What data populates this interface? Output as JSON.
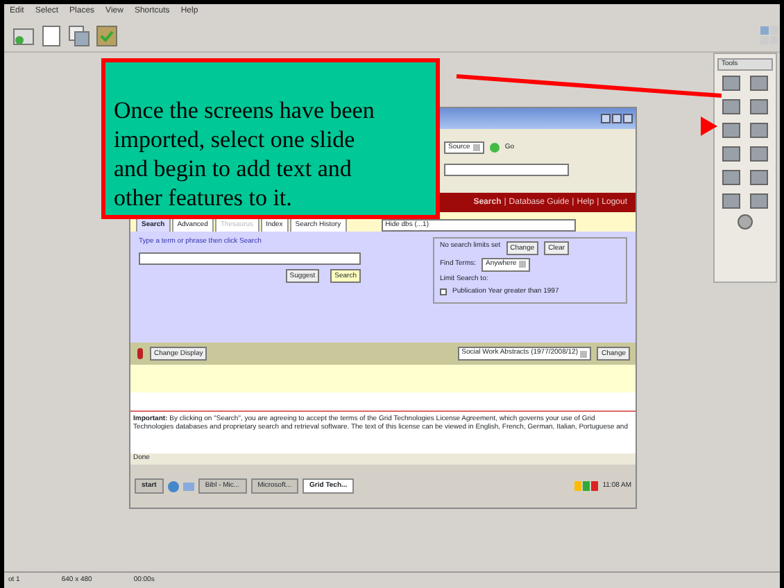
{
  "menu": [
    "Edit",
    "Select",
    "Places",
    "View",
    "Shortcuts",
    "Help"
  ],
  "callout": {
    "text": "Once the screens have been imported, select one slide and begin to add text and other features to it."
  },
  "slide": {
    "address_select": "Source",
    "go_label": "Go",
    "header_links": [
      "Search",
      "Database Guide",
      "Help",
      "Logout"
    ],
    "header_separator": "|",
    "tabs": [
      {
        "label": "Search",
        "selected": true,
        "disabled": false
      },
      {
        "label": "Advanced",
        "selected": false,
        "disabled": false
      },
      {
        "label": "Thesaurus",
        "selected": false,
        "disabled": true
      },
      {
        "label": "Index",
        "selected": false,
        "disabled": false
      },
      {
        "label": "Search History",
        "selected": false,
        "disabled": false
      }
    ],
    "db_select": "Hide dbs (...1)",
    "hint": "Type a term or phrase then click Search",
    "buttons": [
      "Suggest",
      "Search"
    ],
    "limits": {
      "label": "No search limits set",
      "change": "Change",
      "clear": "Clear",
      "find_terms_label": "Find Terms:",
      "find_terms_value": "Anywhere",
      "limit_label": "Limit Search to:",
      "publication": {
        "label": "Publication Year greater than 1997",
        "checked": false
      }
    },
    "display_button": "Change Display",
    "display_select": "Social Work Abstracts (1977/2008/12)",
    "change_button": "Change",
    "notice": {
      "before": "**Important:** By clicking on \"Search\", you are agreeing to accept the terms of the Grid Technologies",
      "link": "License Agreement",
      "after": ", which governs your use of Grid Technologies databases and proprietary search and retrieval software. The text of this license can be viewed in English, French, German, Italian, Portuguese and"
    },
    "status": "Done",
    "taskbar": {
      "start": "start",
      "items": [
        {
          "label": "Bibl - Mic...",
          "active": false
        },
        {
          "label": "Microsoft...",
          "active": false
        },
        {
          "label": "Grid Tech...",
          "active": true
        }
      ],
      "clock": "11:08 AM"
    }
  },
  "palette": {
    "select": "Tools"
  },
  "status_bar": [
    "ot 1",
    "640 x 480",
    "00:00s"
  ]
}
